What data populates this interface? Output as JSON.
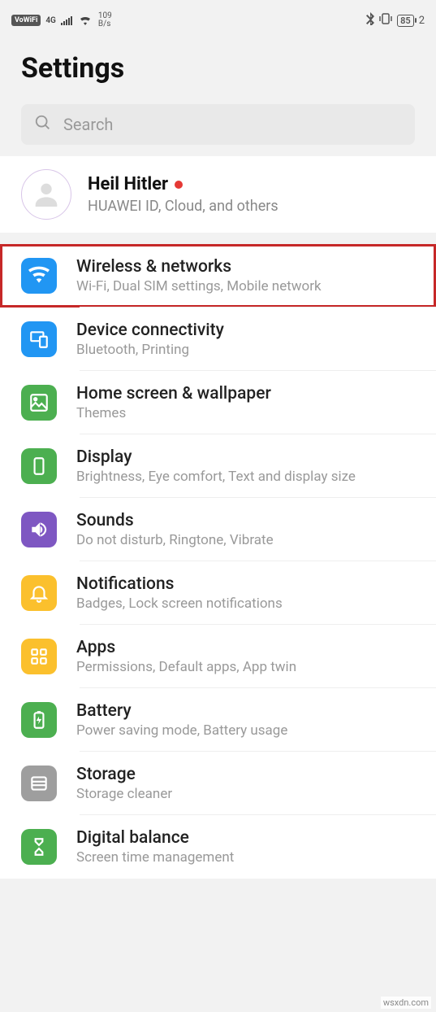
{
  "statusbar": {
    "vowifi": "VoWiFi",
    "net": "4G",
    "speed_num": "109",
    "speed_unit": "B/s",
    "battery": "85",
    "time_fragment": "2"
  },
  "page_title": "Settings",
  "search": {
    "placeholder": "Search"
  },
  "account": {
    "name": "Heil Hitler",
    "sub": "HUAWEI ID, Cloud, and others"
  },
  "items": [
    {
      "title": "Wireless & networks",
      "sub": "Wi-Fi, Dual SIM settings, Mobile network",
      "icon": "wifi",
      "color": "blue",
      "highlighted": true
    },
    {
      "title": "Device connectivity",
      "sub": "Bluetooth, Printing",
      "icon": "device",
      "color": "blue"
    },
    {
      "title": "Home screen & wallpaper",
      "sub": "Themes",
      "icon": "wallpaper",
      "color": "green"
    },
    {
      "title": "Display",
      "sub": "Brightness, Eye comfort, Text and display size",
      "icon": "display",
      "color": "green"
    },
    {
      "title": "Sounds",
      "sub": "Do not disturb, Ringtone, Vibrate",
      "icon": "sound",
      "color": "purple"
    },
    {
      "title": "Notifications",
      "sub": "Badges, Lock screen notifications",
      "icon": "bell",
      "color": "yellow"
    },
    {
      "title": "Apps",
      "sub": "Permissions, Default apps, App twin",
      "icon": "apps",
      "color": "yellow"
    },
    {
      "title": "Battery",
      "sub": "Power saving mode, Battery usage",
      "icon": "battery",
      "color": "green"
    },
    {
      "title": "Storage",
      "sub": "Storage cleaner",
      "icon": "storage",
      "color": "grey"
    },
    {
      "title": "Digital balance",
      "sub": "Screen time management",
      "icon": "hourglass",
      "color": "green"
    }
  ],
  "watermark": "wsxdn.com"
}
